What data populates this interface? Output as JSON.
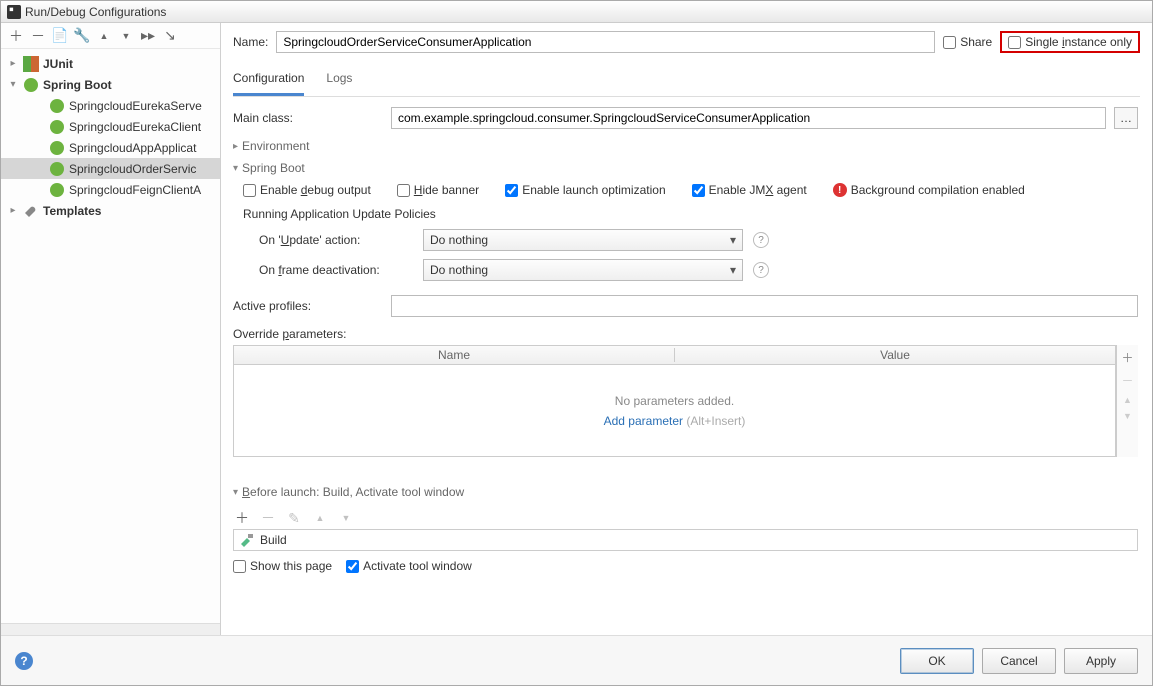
{
  "window": {
    "title": "Run/Debug Configurations"
  },
  "sidebar": {
    "items": [
      {
        "label": "JUnit",
        "expanded": false,
        "type": "junit"
      },
      {
        "label": "Spring Boot",
        "expanded": true,
        "type": "springboot",
        "children": [
          {
            "label": "SpringcloudEurekaServe"
          },
          {
            "label": "SpringcloudEurekaClient"
          },
          {
            "label": "SpringcloudAppApplicat"
          },
          {
            "label": "SpringcloudOrderServic",
            "selected": true
          },
          {
            "label": "SpringcloudFeignClientA"
          }
        ]
      },
      {
        "label": "Templates",
        "expanded": false,
        "type": "templates"
      }
    ]
  },
  "name": {
    "label": "Name:",
    "value": "SpringcloudOrderServiceConsumerApplication"
  },
  "share": {
    "label": "Share",
    "checked": false
  },
  "single": {
    "label": "Single instance only",
    "checked": false
  },
  "tabs": {
    "configuration": "Configuration",
    "logs": "Logs"
  },
  "mainclass": {
    "label": "Main class:",
    "value": "com.example.springcloud.consumer.SpringcloudServiceConsumerApplication"
  },
  "environment": {
    "label": "Environment"
  },
  "springboot": {
    "label": "Spring Boot",
    "enable_debug": "Enable debug output",
    "hide_banner": "Hide banner",
    "enable_launch_opt": "Enable launch optimization",
    "enable_jmx": "Enable JMX agent",
    "bg_compile": "Background compilation enabled",
    "policies_title": "Running Application Update Policies",
    "on_update_label": "On 'Update' action:",
    "on_update_value": "Do nothing",
    "on_frame_label": "On frame deactivation:",
    "on_frame_value": "Do nothing",
    "active_profiles_label": "Active profiles:",
    "active_profiles_value": "",
    "override_label": "Override parameters:",
    "col_name": "Name",
    "col_value": "Value",
    "no_params": "No parameters added.",
    "add_param": "Add parameter",
    "add_hint": "(Alt+Insert)"
  },
  "before": {
    "header": "Before launch: Build, Activate tool window",
    "build": "Build",
    "show_this_page": "Show this page",
    "activate_tool": "Activate tool window"
  },
  "footer": {
    "ok": "OK",
    "cancel": "Cancel",
    "apply": "Apply"
  }
}
